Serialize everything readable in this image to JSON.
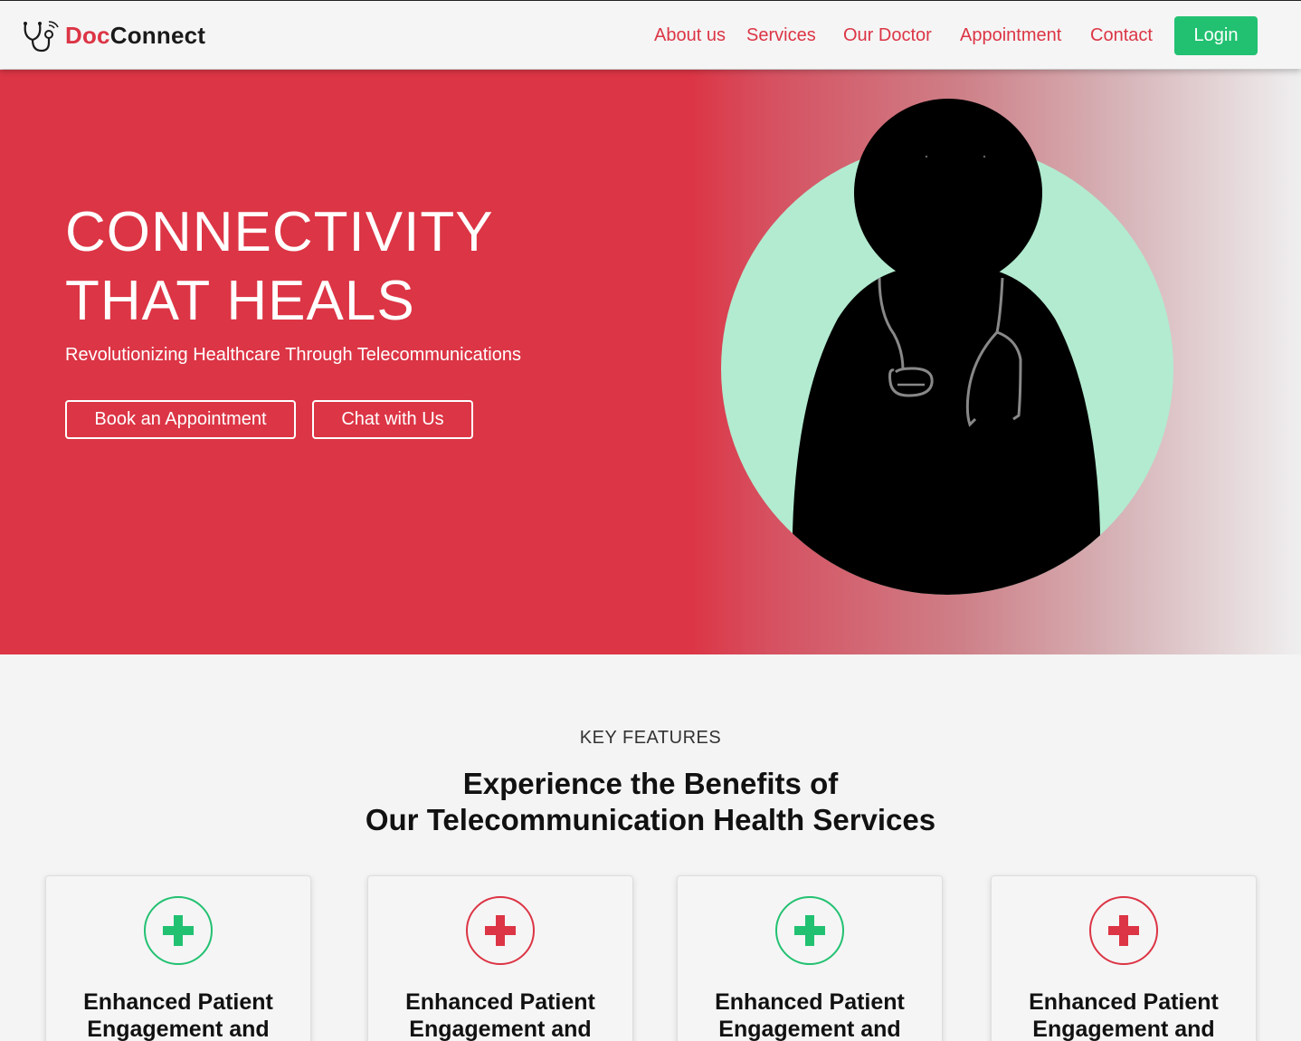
{
  "brand": {
    "doc": "Doc",
    "connect": "Connect",
    "logo_icon": "stethoscope-wifi-icon"
  },
  "nav": {
    "links": [
      "About us",
      "Services",
      "Our Doctor",
      "Appointment",
      "Contact"
    ],
    "login": "Login"
  },
  "hero": {
    "title_line1": "CONNECTIVITY",
    "title_line2": "THAT HEALS",
    "subtitle": "Revolutionizing Healthcare Through Telecommunications",
    "buttons": [
      "Book an Appointment",
      "Chat with Us"
    ]
  },
  "features": {
    "label": "KEY FEATURES",
    "title_line1": "Experience the Benefits of",
    "title_line2": "Our Telecommunication Health Services",
    "cards": [
      {
        "title_line1": "Enhanced Patient",
        "title_line2": "Engagement and",
        "icon": "medical-cross-icon",
        "color": "#22c171"
      },
      {
        "title_line1": "Enhanced Patient",
        "title_line2": "Engagement and",
        "icon": "medical-cross-icon",
        "color": "#dc3545"
      },
      {
        "title_line1": "Enhanced Patient",
        "title_line2": "Engagement and",
        "icon": "medical-cross-icon",
        "color": "#22c171"
      },
      {
        "title_line1": "Enhanced Patient",
        "title_line2": "Engagement and",
        "icon": "medical-cross-icon",
        "color": "#dc3545"
      }
    ]
  },
  "colors": {
    "primary": "#dc3545",
    "success": "#22c171",
    "mint": "#b2ebd0"
  }
}
